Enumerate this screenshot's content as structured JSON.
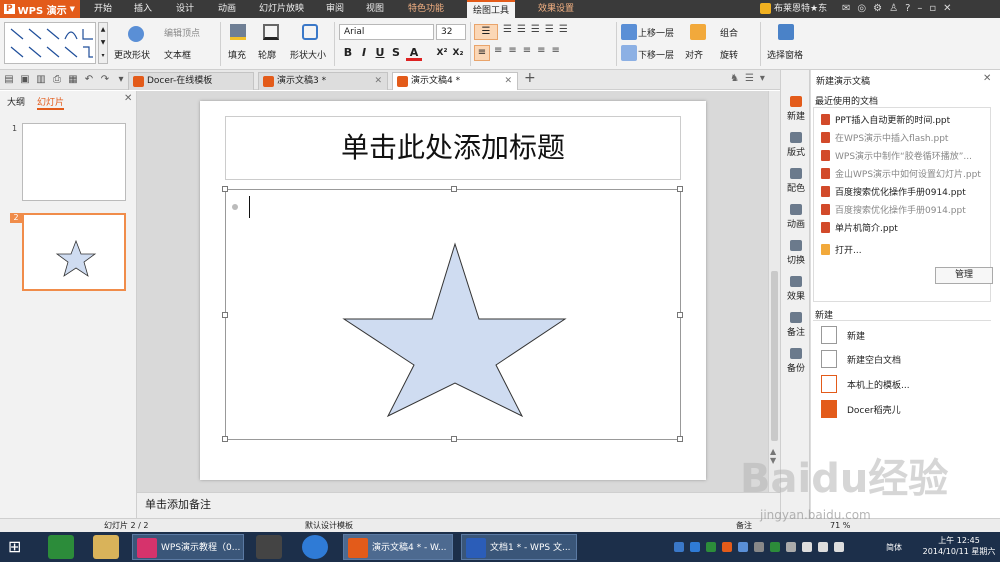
{
  "app": {
    "name": "WPS 演示",
    "accent": "#e35b1a"
  },
  "menu_tabs": [
    {
      "label": "开始"
    },
    {
      "label": "插入"
    },
    {
      "label": "设计"
    },
    {
      "label": "动画"
    },
    {
      "label": "幻灯片放映"
    },
    {
      "label": "审阅"
    },
    {
      "label": "视图"
    },
    {
      "label": "特色功能"
    },
    {
      "label": "绘图工具"
    },
    {
      "label": "效果设置"
    }
  ],
  "account": {
    "user": "布莱恩特★东"
  },
  "ribbon": {
    "change_shape": "更改形状",
    "edit_vertex": "编辑顶点",
    "text_box": "文本框",
    "fill": "填充",
    "outline": "轮廓",
    "shape_size": "形状大小",
    "font": "Arial",
    "font_size": "32",
    "bring_forward": "上移一层",
    "send_backward": "下移一层",
    "group": "组合",
    "align": "对齐",
    "rotate": "旋转",
    "selection_pane": "选择窗格"
  },
  "doc_tabs": [
    {
      "label": "Docer-在线模板",
      "color": "#e35b1a"
    },
    {
      "label": "演示文稿3 *",
      "color": "#e35b1a"
    },
    {
      "label": "演示文稿4 *",
      "color": "#e35b1a"
    }
  ],
  "left_panel": {
    "tab_outline": "大纲",
    "tab_slides": "幻灯片",
    "slides": [
      "1",
      "2"
    ]
  },
  "slide": {
    "title_placeholder": "单击此处添加标题",
    "star_fill": "#cfdcf1"
  },
  "notes_placeholder": "单击添加备注",
  "side_strip": [
    {
      "label": "新建"
    },
    {
      "label": "版式"
    },
    {
      "label": "配色"
    },
    {
      "label": "动画"
    },
    {
      "label": "切换"
    },
    {
      "label": "效果"
    },
    {
      "label": "备注"
    },
    {
      "label": "备份"
    }
  ],
  "task_pane": {
    "header": "新建演示文稿",
    "recent_title": "最近使用的文档",
    "recent_files": [
      {
        "name": "PPT插入自动更新的时间.ppt",
        "dim": false
      },
      {
        "name": "在WPS演示中插入flash.ppt",
        "dim": true
      },
      {
        "name": "WPS演示中制作“胶卷循环播放”...",
        "dim": true
      },
      {
        "name": "金山WPS演示中如何设置幻灯片.ppt",
        "dim": true
      },
      {
        "name": "百度搜索优化操作手册0914.ppt",
        "dim": false
      },
      {
        "name": "百度搜索优化操作手册0914.ppt",
        "dim": true
      },
      {
        "name": "单片机简介.ppt",
        "dim": false
      }
    ],
    "open_label": "打开...",
    "manage_button": "管理",
    "new_section": "新建",
    "new_items": [
      {
        "label": "新建"
      },
      {
        "label": "新建空白文档"
      },
      {
        "label": "本机上的模板..."
      },
      {
        "label": "Docer稻壳儿"
      }
    ]
  },
  "status": {
    "slide_count": "幻灯片 2 / 2",
    "template": "默认设计模板",
    "notes": "备注",
    "zoom": "71 %"
  },
  "taskbar": {
    "tasks": [
      {
        "label": "WPS演示教程（0...",
        "color": "#d6336c"
      },
      {
        "label": "演示文稿4 * - W...",
        "color": "#e35b1a"
      },
      {
        "label": "文档1 * - WPS 文...",
        "color": "#2b5db8"
      }
    ],
    "ime": "简体",
    "time": "上午 12:45",
    "date": "2014/10/11 星期六"
  },
  "watermark": {
    "text": "Baidu经验",
    "url": "jingyan.baidu.com"
  }
}
